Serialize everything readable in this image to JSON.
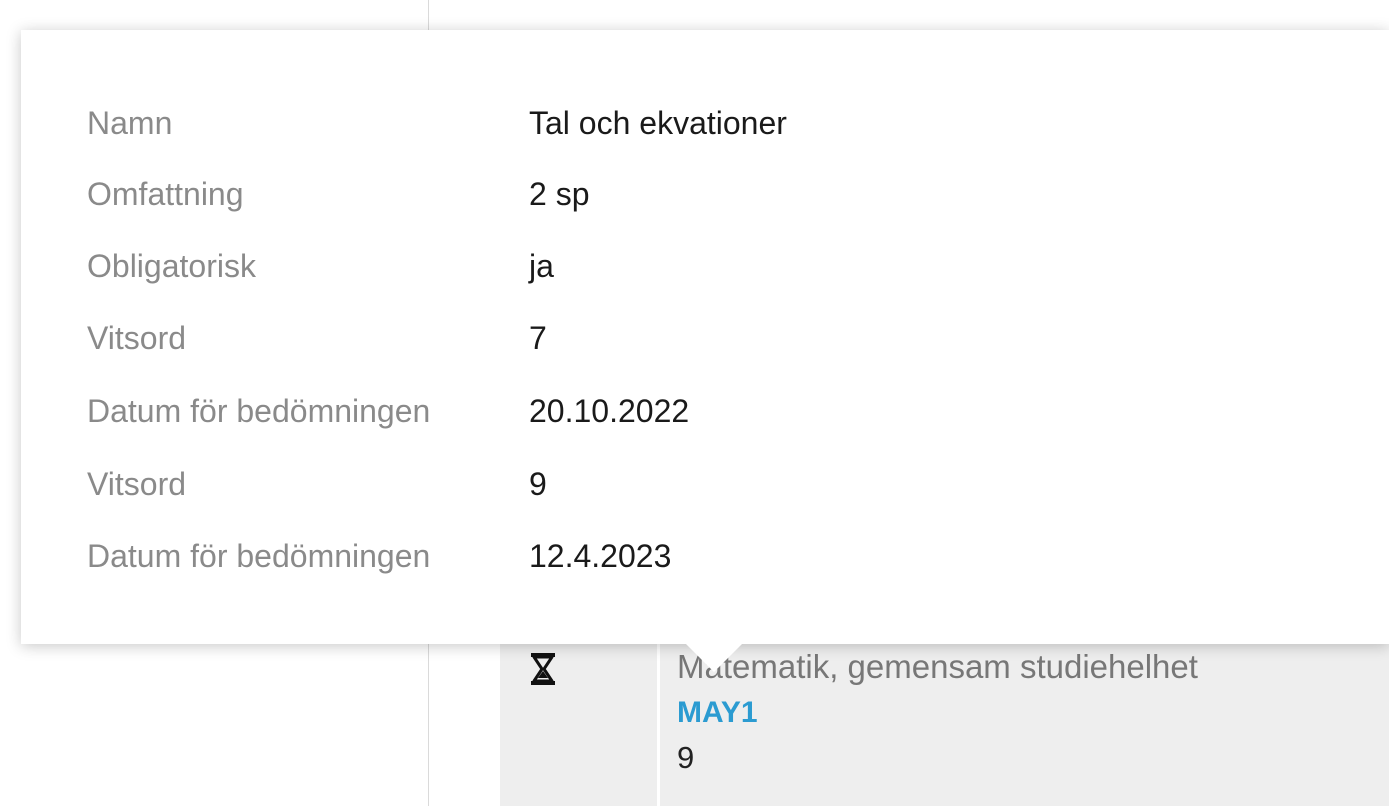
{
  "popup": {
    "rows": [
      {
        "label": "Namn",
        "value": "Tal och ekvationer"
      },
      {
        "label": "Omfattning",
        "value": "2 sp"
      },
      {
        "label": "Obligatorisk",
        "value": "ja"
      },
      {
        "label": "Vitsord",
        "value": "7"
      },
      {
        "label": "Datum för bedömningen",
        "value": "20.10.2022"
      },
      {
        "label": "Vitsord",
        "value": "9"
      },
      {
        "label": "Datum för bedömningen",
        "value": "12.4.2023"
      }
    ]
  },
  "course_row": {
    "icon": "hourglass-icon",
    "name": "Matematik, gemensam studiehelhet",
    "code": "MAY1",
    "grade": "9"
  },
  "colors": {
    "label": "#8a8a8a",
    "value": "#1a1a1a",
    "link": "#2b9bd1",
    "row_bg": "#eeeeee"
  }
}
